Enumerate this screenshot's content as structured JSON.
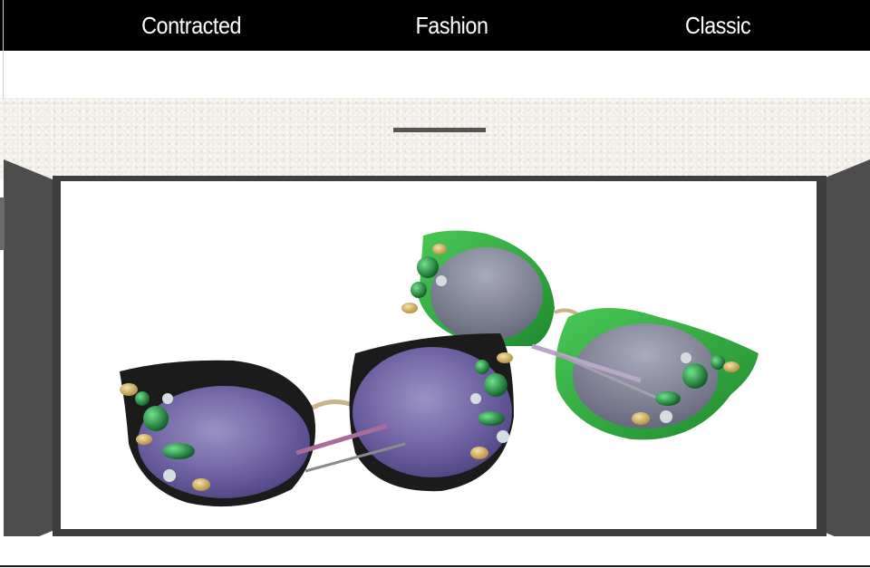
{
  "header": {
    "tabs": [
      {
        "label": "Contracted"
      },
      {
        "label": "Fashion"
      },
      {
        "label": "Classic"
      }
    ]
  },
  "product_image": {
    "subject": "two pairs of jeweled cat-eye sunglasses",
    "frame_colors": [
      "#1a1a1a",
      "#2fae3c"
    ],
    "lens_color": "#7a6fa8"
  }
}
